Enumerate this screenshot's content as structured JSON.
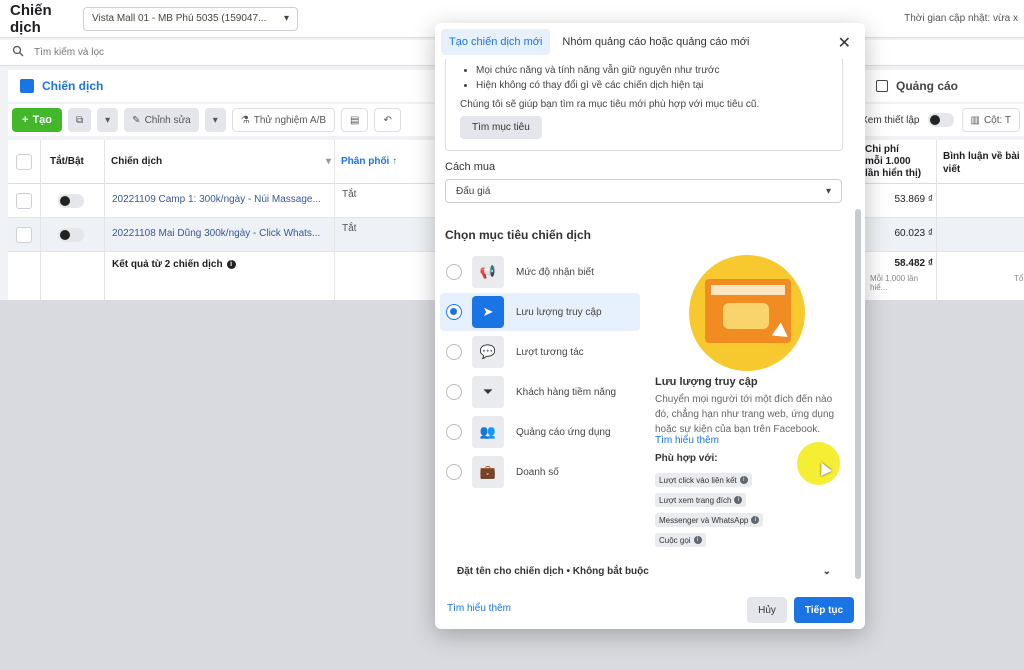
{
  "app": {
    "title": "Chiến dịch",
    "account": "Vista Mall 01 - MB Phú 5035 (159047...",
    "updated": "Thời gian cập nhật: vừa x"
  },
  "search": {
    "placeholder": "Tìm kiếm và lọc"
  },
  "tabs": {
    "campaigns": "Chiến dịch",
    "ads": "Quảng cáo"
  },
  "toolbar": {
    "create": "Tạo",
    "edit": "Chỉnh sửa",
    "ab_test": "Thử nghiệm A/B",
    "view_setup": "Xem thiết lập",
    "columns": "Cột: T"
  },
  "table": {
    "headers": {
      "onoff": "Tắt/Bật",
      "campaign": "Chiến dịch",
      "delivery": "Phân phối ↑",
      "cost": "Chi phí\nmỗi 1.000\nlần hiển thị)",
      "comments": "Bình luận về bài viết"
    },
    "rows": [
      {
        "name": "20221109 Camp 1: 300k/ngày - Núi Massage...",
        "delivery": "Tắt",
        "cost": "53.869 ₫"
      },
      {
        "name": "20221108 Mai Dũng 300k/ngày - Click Whats...",
        "delivery": "Tắt",
        "cost": "60.023 ₫"
      }
    ],
    "summary": {
      "label": "Kết quả từ 2 chiến dịch",
      "cost": "58.482 ₫",
      "cost_sub": "Mỗi 1.000 lần hiể...",
      "extra": "Tổ"
    }
  },
  "modal": {
    "tab_new": "Tạo chiến dịch mới",
    "tab_existing": "Nhóm quảng cáo hoặc quảng cáo mới",
    "notice": {
      "bullets": [
        "Mọi chức năng và tính năng vẫn giữ nguyên như trước",
        "Hiện không có thay đổi gì về các chiến dịch hiện tại"
      ],
      "text": "Chúng tôi sẽ giúp bạn tìm ra mục tiêu mới phù hợp với mục tiêu cũ.",
      "button": "Tìm mục tiêu"
    },
    "buying_label": "Cách mua",
    "buying_value": "Đấu giá",
    "objective_title": "Chọn mục tiêu chiến dịch",
    "objectives": [
      {
        "label": "Mức độ nhận biết",
        "icon": "megaphone-icon"
      },
      {
        "label": "Lưu lượng truy cập",
        "icon": "cursor-icon"
      },
      {
        "label": "Lượt tương tác",
        "icon": "chat-icon"
      },
      {
        "label": "Khách hàng tiềm năng",
        "icon": "funnel-icon"
      },
      {
        "label": "Quảng cáo ứng dụng",
        "icon": "people-icon"
      },
      {
        "label": "Doanh số",
        "icon": "briefcase-icon"
      }
    ],
    "selected_index": 1,
    "detail": {
      "title": "Lưu lượng truy cập",
      "desc": "Chuyển mọi người tới một đích đến nào đó, chẳng hạn như trang web, ứng dụng hoặc sự kiện của bạn trên Facebook.",
      "learn_more": "Tìm hiểu thêm",
      "fit_title": "Phù hợp với:",
      "chips": [
        "Lượt click vào liên kết",
        "Lượt xem trang đích",
        "Messenger và WhatsApp",
        "Cuộc gọi"
      ]
    },
    "naming": "Đặt tên cho chiến dịch • Không bắt buộc",
    "footer": {
      "learn_more": "Tìm hiểu thêm",
      "cancel": "Hủy",
      "next": "Tiếp tục"
    }
  },
  "colors": {
    "accent": "#1b74e4",
    "create": "#42b72a"
  }
}
